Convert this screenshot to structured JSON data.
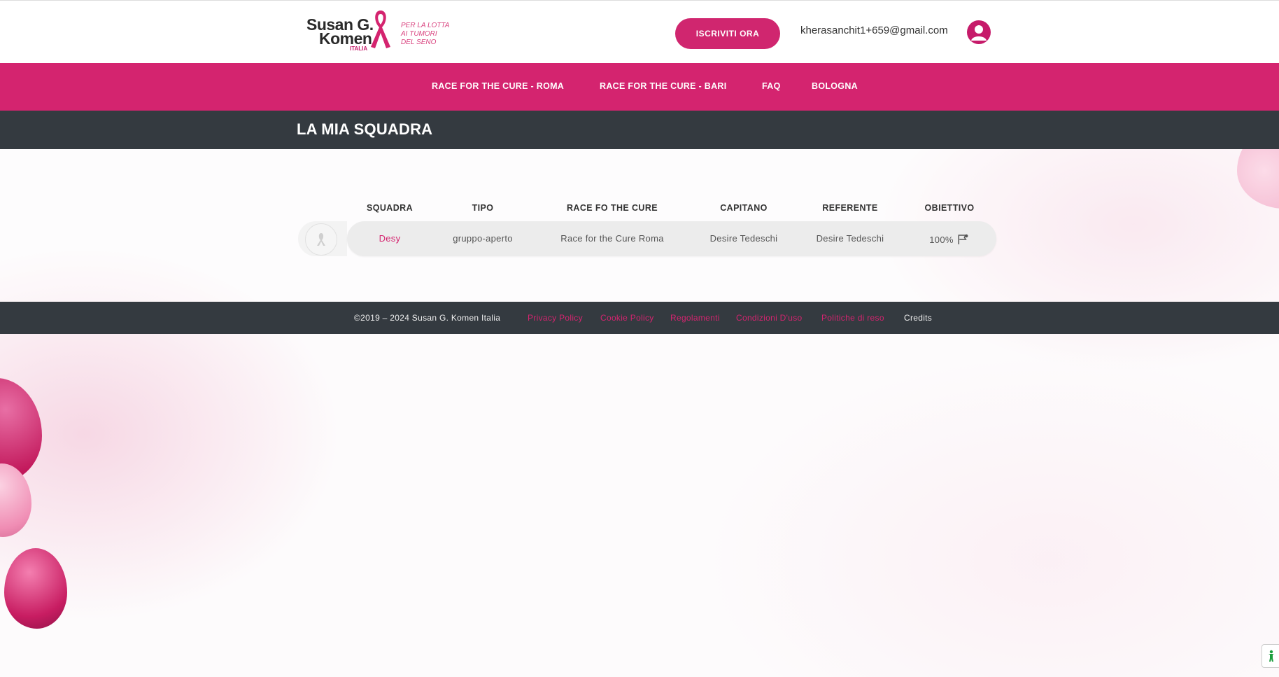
{
  "header": {
    "logo_line1": "Susan G.",
    "logo_line2": "Komen",
    "logo_sub": "ITALIA",
    "tagline_1": "PER LA LOTTA",
    "tagline_2": "AI TUMORI",
    "tagline_3": "DEL SENO",
    "cta_label": "ISCRIVITI ORA",
    "user_email": "kherasanchit1+659@gmail.com"
  },
  "nav": {
    "items": [
      {
        "label": "RACE FOR THE CURE - ROMA"
      },
      {
        "label": "RACE FOR THE CURE - BARI"
      },
      {
        "label": "FAQ"
      },
      {
        "label": "BOLOGNA"
      }
    ]
  },
  "page": {
    "title": "LA MIA SQUADRA"
  },
  "table": {
    "columns": [
      "SQUADRA",
      "TIPO",
      "RACE FO THE CURE",
      "CAPITANO",
      "REFERENTE",
      "OBIETTIVO"
    ],
    "rows": [
      {
        "squadra": "Desy",
        "tipo": "gruppo-aperto",
        "race": "Race for the Cure Roma",
        "capitano": "Desire Tedeschi",
        "referente": "Desire Tedeschi",
        "obiettivo": "100%"
      }
    ]
  },
  "footer": {
    "copyright": "©2019 – 2024 Susan G. Komen Italia",
    "links": [
      "Privacy Policy",
      "Cookie Policy",
      "Regolamenti",
      "Condizioni D'uso",
      "Politiche di reso"
    ],
    "credits": "Credits"
  },
  "colors": {
    "brand_pink": "#d4246f",
    "dark_bar": "#343a40"
  },
  "icons": {
    "user": "user-circle-icon",
    "row": "ribbon-icon",
    "goal": "flag-icon",
    "accessibility": "accessibility-icon"
  }
}
